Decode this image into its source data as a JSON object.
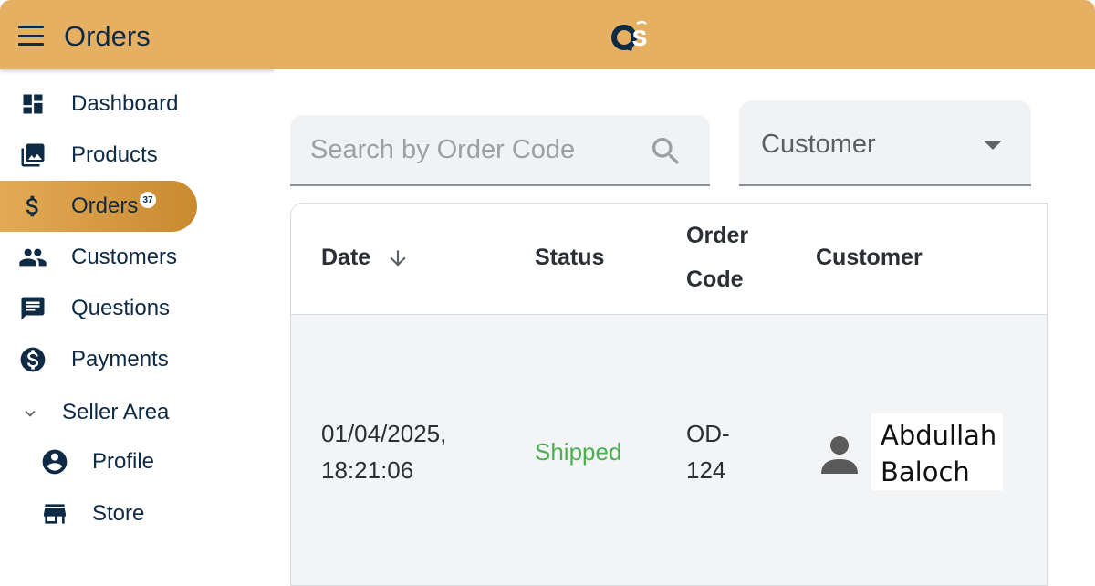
{
  "header": {
    "title": "Orders",
    "logo_text": "OS",
    "brand_color": "#e5b062"
  },
  "sidebar": {
    "items": [
      {
        "label": "Dashboard",
        "icon": "dashboard-icon"
      },
      {
        "label": "Products",
        "icon": "photo-library-icon"
      },
      {
        "label": "Orders",
        "icon": "dollar-icon",
        "badge": "37",
        "active": true
      },
      {
        "label": "Customers",
        "icon": "people-icon"
      },
      {
        "label": "Questions",
        "icon": "chat-icon"
      },
      {
        "label": "Payments",
        "icon": "dollar-circle-icon"
      }
    ],
    "section": {
      "label": "Seller Area",
      "icon": "chevron-down-icon",
      "items": [
        {
          "label": "Profile",
          "icon": "account-circle-icon"
        },
        {
          "label": "Store",
          "icon": "store-icon"
        }
      ]
    }
  },
  "filters": {
    "search_placeholder": "Search by Order Code",
    "search_value": "",
    "customer_select_value": "Customer"
  },
  "table": {
    "columns": [
      "Date",
      "Status",
      "Order Code",
      "Customer"
    ],
    "column_lines": {
      "order_code": [
        "Order",
        "Code"
      ]
    },
    "sort": {
      "column": "Date",
      "direction": "desc"
    },
    "rows": [
      {
        "date_line1": "01/04/2025,",
        "date_line2": "18:21:06",
        "status": "Shipped",
        "order_code_line1": "OD-",
        "order_code_line2": "124",
        "customer_line1": "Abdullah",
        "customer_line2": "Baloch"
      }
    ]
  },
  "colors": {
    "accent": "#e5b062",
    "navy": "#0f2a44",
    "status_shipped": "#4caf50"
  }
}
